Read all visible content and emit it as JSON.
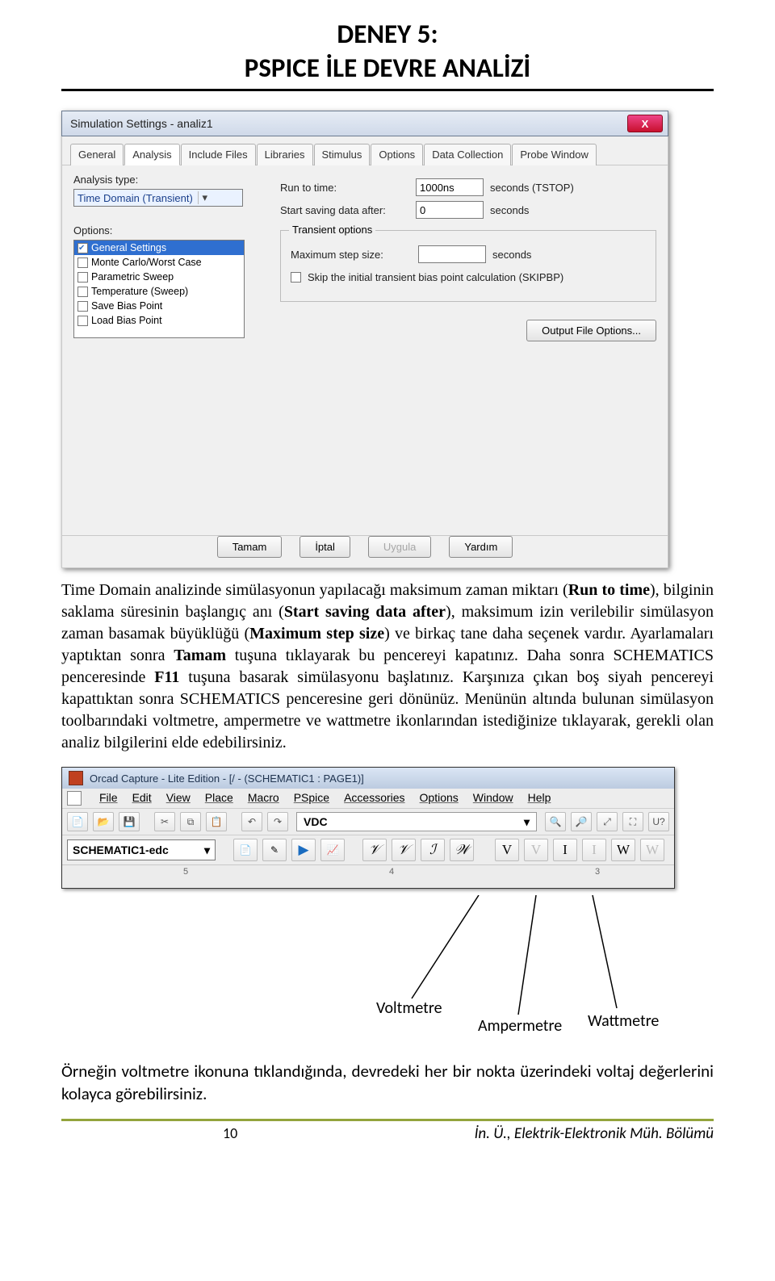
{
  "doc": {
    "title_l1": "DENEY 5:",
    "title_l2": "PSPICE İLE DEVRE ANALİZİ",
    "page_number": "10",
    "footer_right": "İn. Ü., Elektrik-Elektronik Müh. Bölümü"
  },
  "dialog": {
    "title": "Simulation Settings - analiz1",
    "close_x": "X",
    "tabs": [
      "General",
      "Analysis",
      "Include Files",
      "Libraries",
      "Stimulus",
      "Options",
      "Data Collection",
      "Probe Window"
    ],
    "active_tab_index": 1,
    "analysis_type_label": "Analysis type:",
    "analysis_type_value": "Time Domain (Transient)",
    "options_label": "Options:",
    "options_items": [
      {
        "label": "General Settings",
        "checked": true,
        "selected": true
      },
      {
        "label": "Monte Carlo/Worst Case",
        "checked": false,
        "selected": false
      },
      {
        "label": "Parametric Sweep",
        "checked": false,
        "selected": false
      },
      {
        "label": "Temperature (Sweep)",
        "checked": false,
        "selected": false
      },
      {
        "label": "Save Bias Point",
        "checked": false,
        "selected": false
      },
      {
        "label": "Load Bias Point",
        "checked": false,
        "selected": false
      }
    ],
    "run_to_time_label": "Run to time:",
    "run_to_time_value": "1000ns",
    "run_to_time_unit": "seconds  (TSTOP)",
    "start_saving_label": "Start saving data after:",
    "start_saving_value": "0",
    "start_saving_unit": "seconds",
    "transient_group": "Transient options",
    "max_step_label": "Maximum step size:",
    "max_step_value": "",
    "max_step_unit": "seconds",
    "skip_label": "Skip the initial transient bias point calculation  (SKIPBP)",
    "output_btn": "Output File Options...",
    "btn_ok": "Tamam",
    "btn_cancel": "İptal",
    "btn_apply": "Uygula",
    "btn_help": "Yardım"
  },
  "paragraph1": {
    "p1": "Time Domain analizinde simülasyonun yapılacağı maksimum zaman miktarı (",
    "b1": "Run to time",
    "p2": "), bilginin saklama süresinin başlangıç anı (",
    "b2": "Start saving data after",
    "p3": "), maksimum izin verilebilir simülasyon zaman basamak büyüklüğü (",
    "b3": "Maximum step size",
    "p4": ") ve birkaç tane daha seçenek vardır. Ayarlamaları yaptıktan sonra ",
    "b4": "Tamam",
    "p5": " tuşuna tıklayarak bu pencereyi kapatınız. Daha sonra SCHEMATICS penceresinde ",
    "b5": "F11",
    "p6": " tuşuna basarak simülasyonu başlatınız. Karşınıza çıkan boş siyah pencereyi kapattıktan sonra SCHEMATICS penceresine geri dönünüz. Menünün altında bulunan simülasyon toolbarındaki voltmetre, ampermetre ve wattmetre ikonlarından istediğinize tıklayarak, gerekli olan analiz bilgilerini elde edebilirsiniz."
  },
  "orcad": {
    "title": "Orcad Capture - Lite Edition - [/ - (SCHEMATIC1 : PAGE1)]",
    "menus": [
      "File",
      "Edit",
      "View",
      "Place",
      "Macro",
      "PSpice",
      "Accessories",
      "Options",
      "Window",
      "Help"
    ],
    "vdc": "VDC",
    "schematic_tab": "SCHEMATIC1-edc",
    "meters": {
      "V": "V",
      "Vd": "V",
      "I": "I",
      "Id": "I",
      "W": "W",
      "Wd": "W"
    },
    "ruler": {
      "5": "5",
      "4": "4",
      "3": "3"
    }
  },
  "labels": {
    "voltmetre": "Voltmetre",
    "ampermetre": "Ampermetre",
    "wattmetre": "Wattmetre"
  },
  "paragraph2": "Örneğin voltmetre ikonuna tıklandığında, devredeki her bir nokta üzerindeki voltaj değerlerini kolayca görebilirsiniz."
}
